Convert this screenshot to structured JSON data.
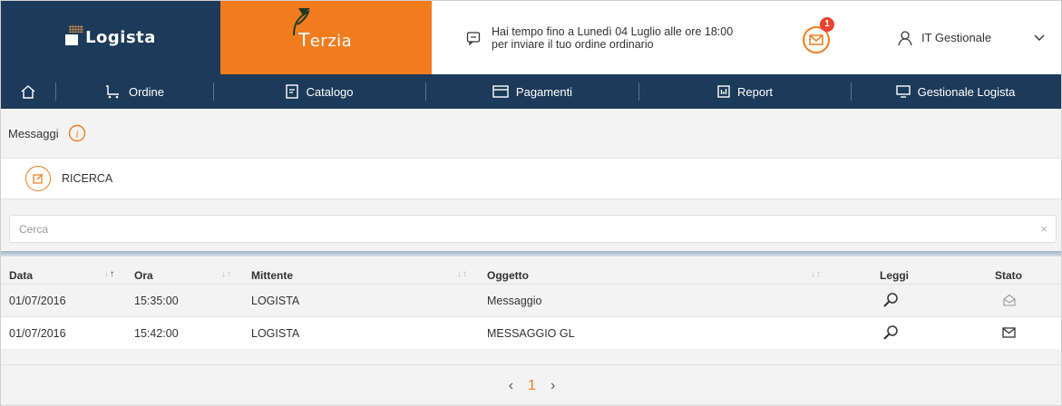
{
  "header": {
    "logista_label": "Logista",
    "terzia_label": "Terzia",
    "notice_line1": "Hai tempo fino a Lunedì 04 Luglio alle ore 18:00",
    "notice_line2": "per inviare il tuo ordine ordinario",
    "mail_badge_count": "1",
    "user_name": "IT Gestionale",
    "colors": {
      "navy": "#1c3a5a",
      "orange": "#f07c1e",
      "badge_red": "#e8412e"
    }
  },
  "nav": {
    "items": [
      {
        "label": "Ordine",
        "icon": "cart-icon"
      },
      {
        "label": "Catalogo",
        "icon": "catalog-icon"
      },
      {
        "label": "Pagamenti",
        "icon": "credit-card-icon"
      },
      {
        "label": "Report",
        "icon": "report-icon"
      },
      {
        "label": "Gestionale Logista",
        "icon": "monitor-icon"
      }
    ]
  },
  "page": {
    "title": "Messaggi",
    "ricerca_label": "RICERCA",
    "search_placeholder": "Cerca",
    "search_clear": "×"
  },
  "table": {
    "headers": {
      "data": "Data",
      "ora": "Ora",
      "mittente": "Mittente",
      "oggetto": "Oggetto",
      "leggi": "Leggi",
      "stato": "Stato"
    },
    "rows": [
      {
        "data": "01/07/2016",
        "ora": "15:35:00",
        "mittente": "LOGISTA",
        "oggetto": "Messaggio",
        "stato": "read"
      },
      {
        "data": "01/07/2016",
        "ora": "15:42:00",
        "mittente": "LOGISTA",
        "oggetto": "MESSAGGIO GL",
        "stato": "unread"
      }
    ]
  },
  "pagination": {
    "prev": "‹",
    "current": "1",
    "next": "›"
  }
}
